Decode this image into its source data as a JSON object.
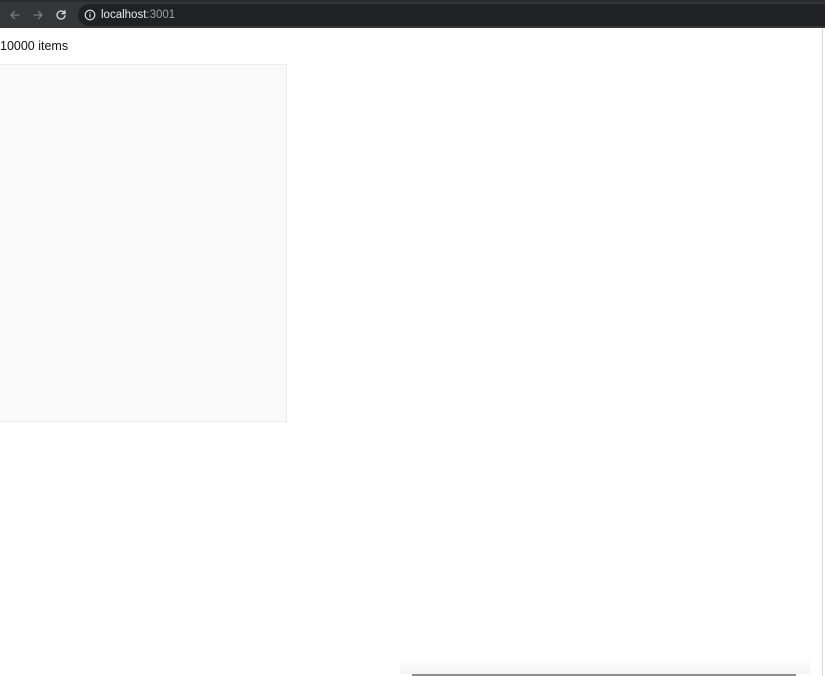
{
  "browser": {
    "url_host": "localhost",
    "url_port": ":3001",
    "back_icon": "arrow-left-icon",
    "forward_icon": "arrow-right-icon",
    "reload_icon": "reload-icon",
    "info_icon": "info-icon"
  },
  "page": {
    "items_count_text": "10000 items"
  },
  "colors": {
    "toolbar": "#35363a",
    "address_bar": "#202124",
    "list_background": "#f9f9f9"
  }
}
